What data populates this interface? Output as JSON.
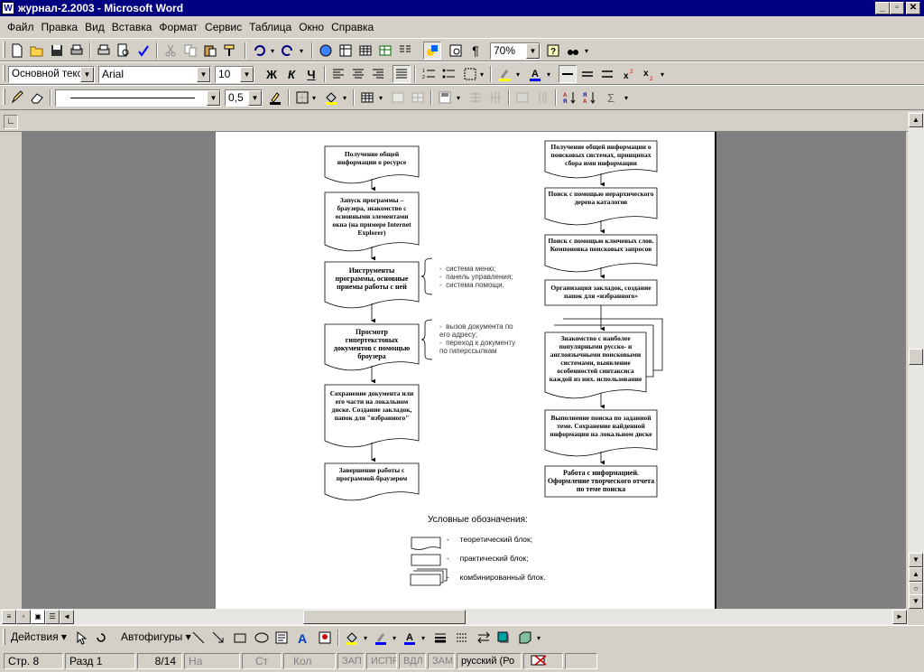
{
  "window": {
    "title": "журнал-2.2003 - Microsoft Word",
    "app_icon": "W",
    "btn_min": "_",
    "btn_restore": "▫",
    "btn_close": "✕"
  },
  "menu": [
    "Файл",
    "Правка",
    "Вид",
    "Вставка",
    "Формат",
    "Сервис",
    "Таблица",
    "Окно",
    "Справка"
  ],
  "toolbar_standard": {
    "zoom": "70%"
  },
  "toolbar_format": {
    "style": "Основной текст",
    "font": "Arial",
    "size": "10",
    "bold": "Ж",
    "italic": "К",
    "underline": "Ч"
  },
  "toolbar_tables": {
    "line_weight": "0,5"
  },
  "flow_left": [
    "Получение общей информации о ресурсе",
    "Запуск программы – браузера, знакомство с основными элементами окна (на примере Internet Explorer)",
    "Инструменты программы, основные приемы работы с ней",
    "Просмотр гипертекстовых документов с помощью броузера",
    "Сохранение документа или его части на локальном диске. Создание закладок, папок для \"избранного\"",
    "Завершение работы с программой-браузером"
  ],
  "notes_1": [
    "система меню;",
    "панель управления;",
    "система помощи."
  ],
  "notes_2": [
    "вызов документа по его адресу;",
    "переход к документу по гиперссылкам"
  ],
  "flow_right": [
    "Получение общей информации о поисковых системах, принципах сбора ими информации",
    "Поиск с помощью иерархического дерева каталогов",
    "Поиск с помощью ключевых слов. Компоновка поисковых запросов",
    "Организация закладок, создание папок для «избранного»",
    "Знакомство с наиболее популярными русско- и англоязычными поисковыми системами, выявление особенностей синтаксиса каждой из них. использование системы",
    "Выполнение поиска по заданной теме. Сохранение найденной информации на локальном диске",
    "Работа с информацией. Оформление творческого отчета по теме поиска"
  ],
  "legend": {
    "title": "Условные обозначения:",
    "items": [
      "теоретический блок;",
      "практический блок;",
      "комбинированный блок."
    ],
    "dash": "-"
  },
  "drawing": {
    "actions": "Действия",
    "autoshapes": "Автофигуры"
  },
  "status": {
    "page": "Стр. 8",
    "section": "Разд 1",
    "pages": "8/14",
    "at": "На",
    "line": "Ст",
    "col": "Кол",
    "rec": "ЗАП",
    "trk": "ИСПР",
    "ext": "ВДЛ",
    "ovr": "ЗАМ",
    "lang": "русский (Ро"
  }
}
